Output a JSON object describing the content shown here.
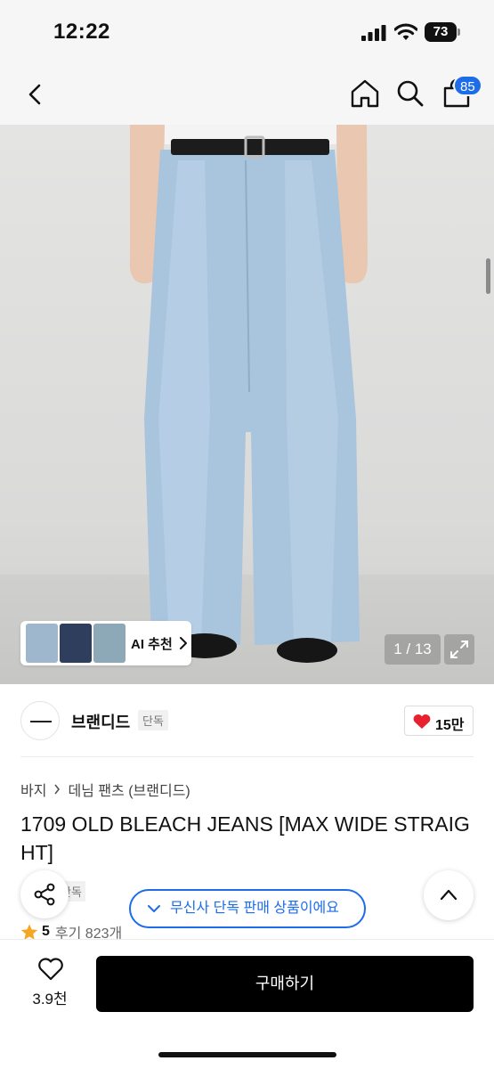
{
  "status_bar": {
    "time": "12:22",
    "battery": "73",
    "icons": [
      "signal-icon",
      "wifi-icon",
      "battery-icon"
    ]
  },
  "nav": {
    "icons": [
      "back-icon",
      "home-icon",
      "search-icon",
      "cart-icon"
    ],
    "cart_badge": "85"
  },
  "gallery": {
    "ai_label": "AI 추천",
    "counter": "1 / 13",
    "icons": [
      "chevron-right-icon",
      "expand-icon"
    ]
  },
  "brand": {
    "name": "브랜디드",
    "tag": "단독",
    "likes": "15만"
  },
  "breadcrumb": {
    "items": [
      "바지",
      "데님 팬츠 (브랜디드)"
    ]
  },
  "product": {
    "title": "1709 OLD BLEACH JEANS [MAX WIDE STRAIGHT]",
    "exclusive_tag": "단독",
    "exclusive_notice": "무신사 단독 판매 상품이에요",
    "rating": "5",
    "reviews": "후기 823개"
  },
  "bottom": {
    "wish_count": "3.9천",
    "buy_label": "구매하기"
  },
  "colors": {
    "accent_blue": "#1d6de8",
    "heart_red": "#e8212e",
    "star_orange": "#f5a623",
    "buy_black": "#000000"
  }
}
